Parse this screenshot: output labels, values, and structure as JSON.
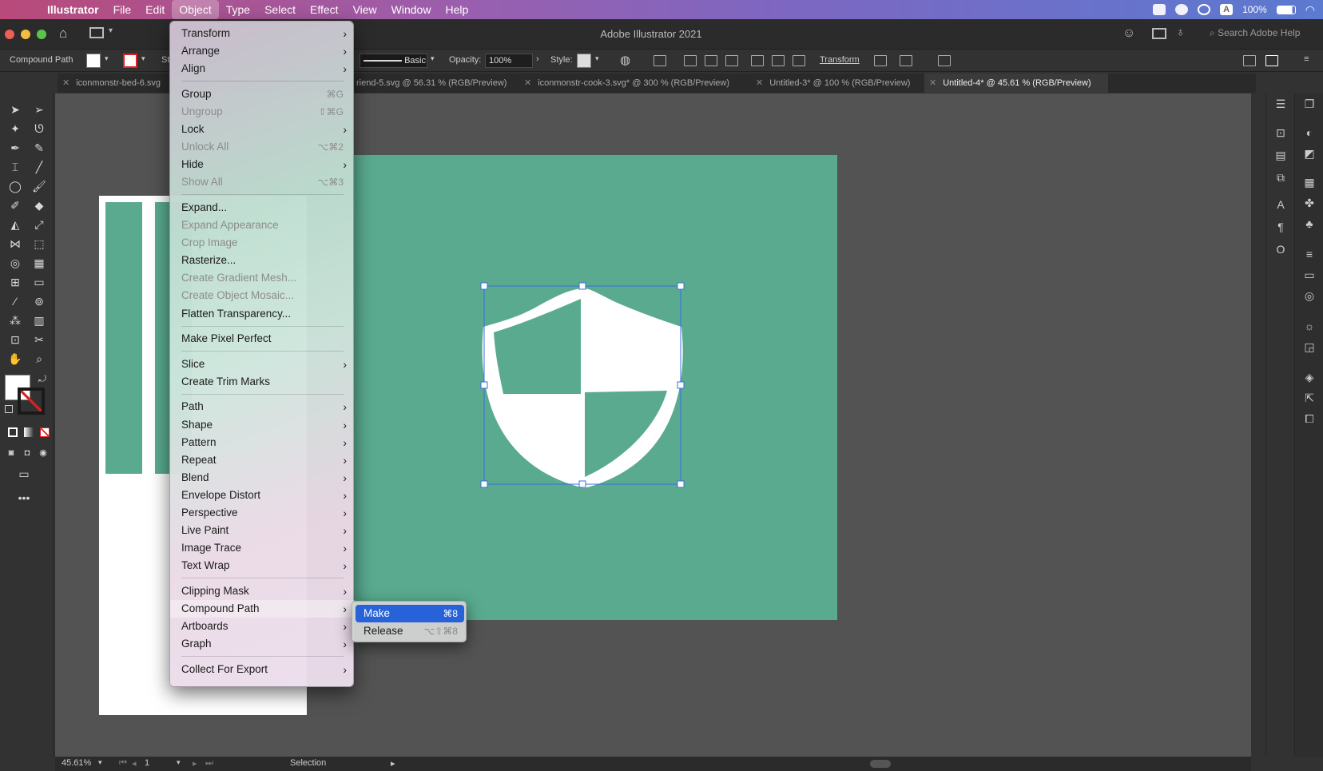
{
  "menubar": {
    "app": "Illustrator",
    "items": [
      "File",
      "Edit",
      "Object",
      "Type",
      "Select",
      "Effect",
      "View",
      "Window",
      "Help"
    ],
    "active": "Object",
    "battery": "100%"
  },
  "titlebar": {
    "title": "Adobe Illustrator 2021",
    "search_placeholder": "Search Adobe Help"
  },
  "control_bar": {
    "selection_type": "Compound Path",
    "stroke_label": "St",
    "brush": "Basic",
    "opacity_label": "Opacity:",
    "opacity_value": "100%",
    "style_label": "Style:",
    "transform_label": "Transform"
  },
  "tabs": [
    {
      "label": "iconmonstr-bed-6.svg",
      "active": false
    },
    {
      "label": "riend-5.svg @ 56.31 % (RGB/Preview)",
      "active": false
    },
    {
      "label": "iconmonstr-cook-3.svg* @ 300 % (RGB/Preview)",
      "active": false
    },
    {
      "label": "Untitled-3* @ 100 % (RGB/Preview)",
      "active": false
    },
    {
      "label": "Untitled-4* @ 45.61 % (RGB/Preview)",
      "active": true
    }
  ],
  "object_menu": [
    {
      "label": "Transform",
      "submenu": true
    },
    {
      "label": "Arrange",
      "submenu": true
    },
    {
      "label": "Align",
      "submenu": true
    },
    {
      "sep": true
    },
    {
      "label": "Group",
      "shortcut": "⌘G"
    },
    {
      "label": "Ungroup",
      "shortcut": "⇧⌘G",
      "disabled": true
    },
    {
      "label": "Lock",
      "submenu": true
    },
    {
      "label": "Unlock All",
      "shortcut": "⌥⌘2",
      "disabled": true
    },
    {
      "label": "Hide",
      "submenu": true
    },
    {
      "label": "Show All",
      "shortcut": "⌥⌘3",
      "disabled": true
    },
    {
      "sep": true
    },
    {
      "label": "Expand..."
    },
    {
      "label": "Expand Appearance",
      "disabled": true
    },
    {
      "label": "Crop Image",
      "disabled": true
    },
    {
      "label": "Rasterize..."
    },
    {
      "label": "Create Gradient Mesh...",
      "disabled": true
    },
    {
      "label": "Create Object Mosaic...",
      "disabled": true
    },
    {
      "label": "Flatten Transparency..."
    },
    {
      "sep": true
    },
    {
      "label": "Make Pixel Perfect"
    },
    {
      "sep": true
    },
    {
      "label": "Slice",
      "submenu": true
    },
    {
      "label": "Create Trim Marks"
    },
    {
      "sep": true
    },
    {
      "label": "Path",
      "submenu": true
    },
    {
      "label": "Shape",
      "submenu": true
    },
    {
      "label": "Pattern",
      "submenu": true
    },
    {
      "label": "Repeat",
      "submenu": true
    },
    {
      "label": "Blend",
      "submenu": true
    },
    {
      "label": "Envelope Distort",
      "submenu": true
    },
    {
      "label": "Perspective",
      "submenu": true
    },
    {
      "label": "Live Paint",
      "submenu": true
    },
    {
      "label": "Image Trace",
      "submenu": true
    },
    {
      "label": "Text Wrap",
      "submenu": true
    },
    {
      "sep": true
    },
    {
      "label": "Clipping Mask",
      "submenu": true
    },
    {
      "label": "Compound Path",
      "submenu": true,
      "highlight": true
    },
    {
      "label": "Artboards",
      "submenu": true
    },
    {
      "label": "Graph",
      "submenu": true
    },
    {
      "sep": true
    },
    {
      "label": "Collect For Export",
      "submenu": true
    }
  ],
  "compound_path_submenu": [
    {
      "label": "Make",
      "shortcut": "⌘8",
      "selected": true
    },
    {
      "label": "Release",
      "shortcut": "⌥⇧⌘8",
      "selected": false
    }
  ],
  "status_bar": {
    "zoom": "45.61%",
    "artboard": "1",
    "tool": "Selection"
  },
  "colors": {
    "artboard_fill": "#59aa8f",
    "selection": "#3b6ee0",
    "menu_highlight": "#2762d8"
  }
}
